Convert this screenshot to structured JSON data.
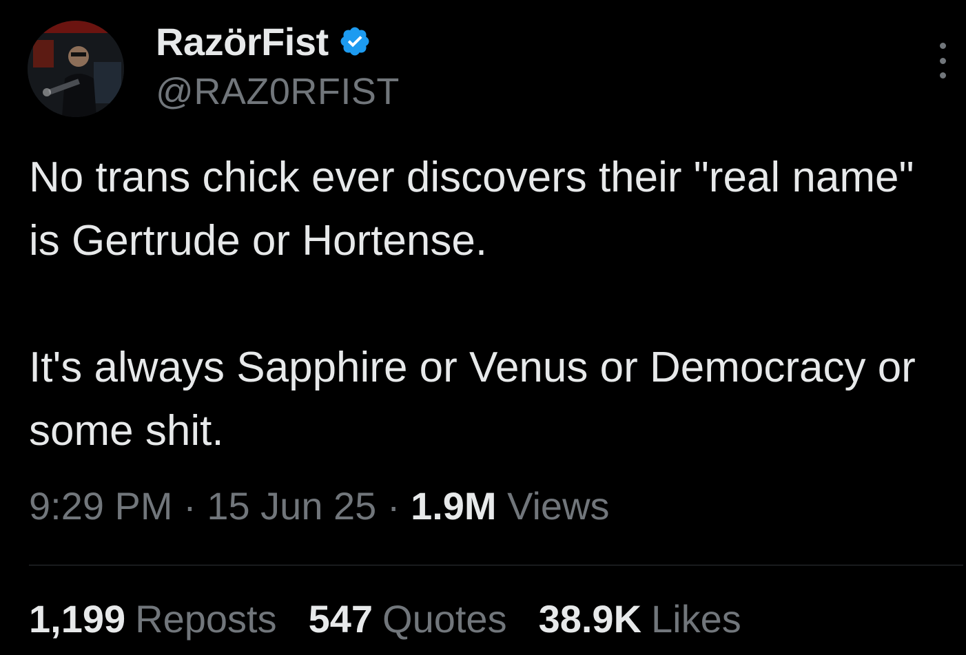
{
  "author": {
    "display_name": "RazörFist",
    "handle": "@RAZ0RFIST",
    "verified_color": "#1d9bf0"
  },
  "tweet": {
    "paragraphs": [
      "No trans chick ever discovers their \"real name\" is Gertrude or Hortense.",
      "It's always Sapphire or Venus or Democracy or some shit."
    ]
  },
  "meta": {
    "time": "9:29 PM",
    "separator": " · ",
    "date": "15 Jun 25",
    "views_count": "1.9M",
    "views_label": "Views"
  },
  "stats": {
    "reposts_count": "1,199",
    "reposts_label": "Reposts",
    "quotes_count": "547",
    "quotes_label": "Quotes",
    "likes_count": "38.9K",
    "likes_label": "Likes"
  },
  "icons": {
    "verified": "verified-badge-icon",
    "more": "more-options-icon"
  },
  "colors": {
    "background": "#000000",
    "primary_text": "#e7e9ea",
    "secondary_text": "#71767b",
    "divider": "#2f3336"
  }
}
